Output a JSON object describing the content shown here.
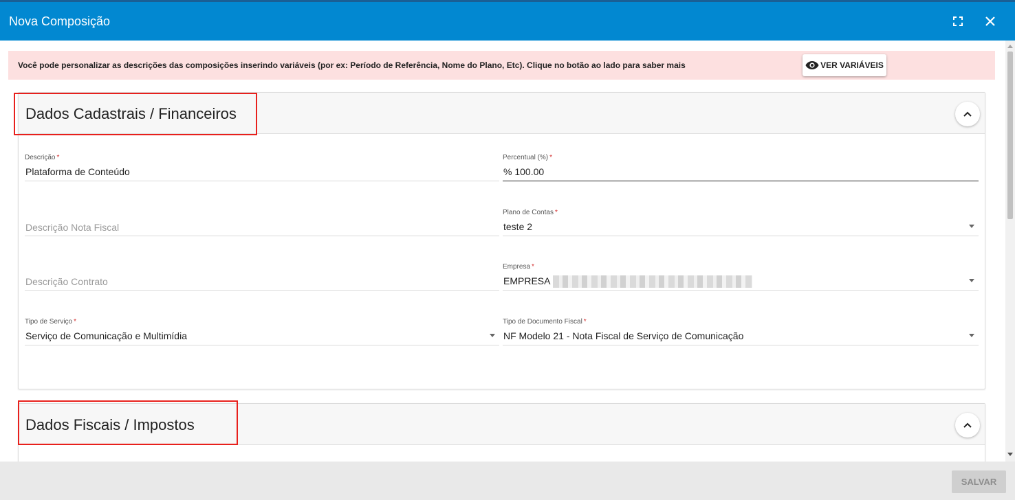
{
  "dialog": {
    "title": "Nova Composição"
  },
  "info": {
    "message": "Você pode personalizar as descrições das composições inserindo variáveis (por ex: Período de Referência, Nome do Plano, Etc). Clique no botão ao lado para saber mais",
    "button_label": "VER VARIÁVEIS"
  },
  "section1": {
    "title": "Dados Cadastrais / Financeiros",
    "fields": {
      "descricao": {
        "label": "Descrição",
        "value": "Plataforma de Conteúdo"
      },
      "percentual": {
        "label": "Percentual (%)",
        "value": "% 100.00"
      },
      "descricao_nf": {
        "placeholder": "Descrição Nota Fiscal"
      },
      "plano_contas": {
        "label": "Plano de Contas",
        "value": "teste 2"
      },
      "descricao_contrato": {
        "placeholder": "Descrição Contrato"
      },
      "empresa": {
        "label": "Empresa",
        "value": "EMPRESA"
      },
      "tipo_servico": {
        "label": "Tipo de Serviço",
        "value": "Serviço de Comunicação e Multimídia"
      },
      "tipo_documento": {
        "label": "Tipo de Documento Fiscal",
        "value": "NF Modelo 21 - Nota Fiscal de Serviço de Comunicação"
      }
    },
    "required_mark": "*"
  },
  "section2": {
    "title": "Dados Fiscais / Impostos"
  },
  "footer": {
    "save_label": "SALVAR"
  },
  "colors": {
    "header": "#0288d1",
    "info_bg": "#fde0e0",
    "highlight": "#e8201c"
  }
}
